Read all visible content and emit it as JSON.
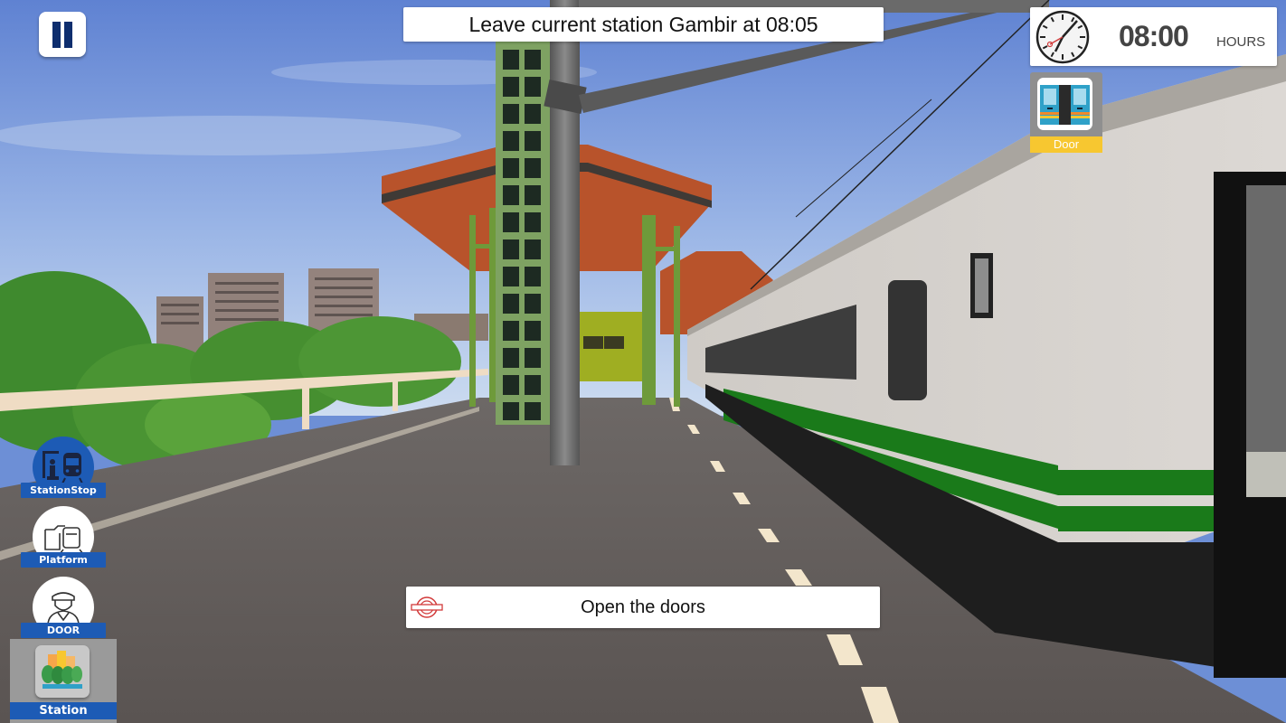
{
  "hud": {
    "pause_label": "Pause",
    "objective": "Leave current station Gambir at 08:05",
    "clock": {
      "time": "08:00",
      "unit": "HOURS"
    },
    "door_tile": {
      "label": "Door"
    },
    "instruction": "Open the doors"
  },
  "side_buttons": [
    {
      "label": "StationStop",
      "icon": "station-stop-icon",
      "style": "blue"
    },
    {
      "label": "Platform",
      "icon": "platform-icon",
      "style": "white"
    },
    {
      "label": "DOOR",
      "icon": "conductor-icon",
      "style": "white"
    },
    {
      "label": "Station",
      "icon": "city-park-icon",
      "style": "gray-tile"
    }
  ],
  "colors": {
    "accent_blue": "#1d5bb5",
    "door_yellow": "#f7c730",
    "pause_navy": "#0e2e6e",
    "train_green": "#1a7a1a",
    "logo_red": "#d23a3a"
  }
}
